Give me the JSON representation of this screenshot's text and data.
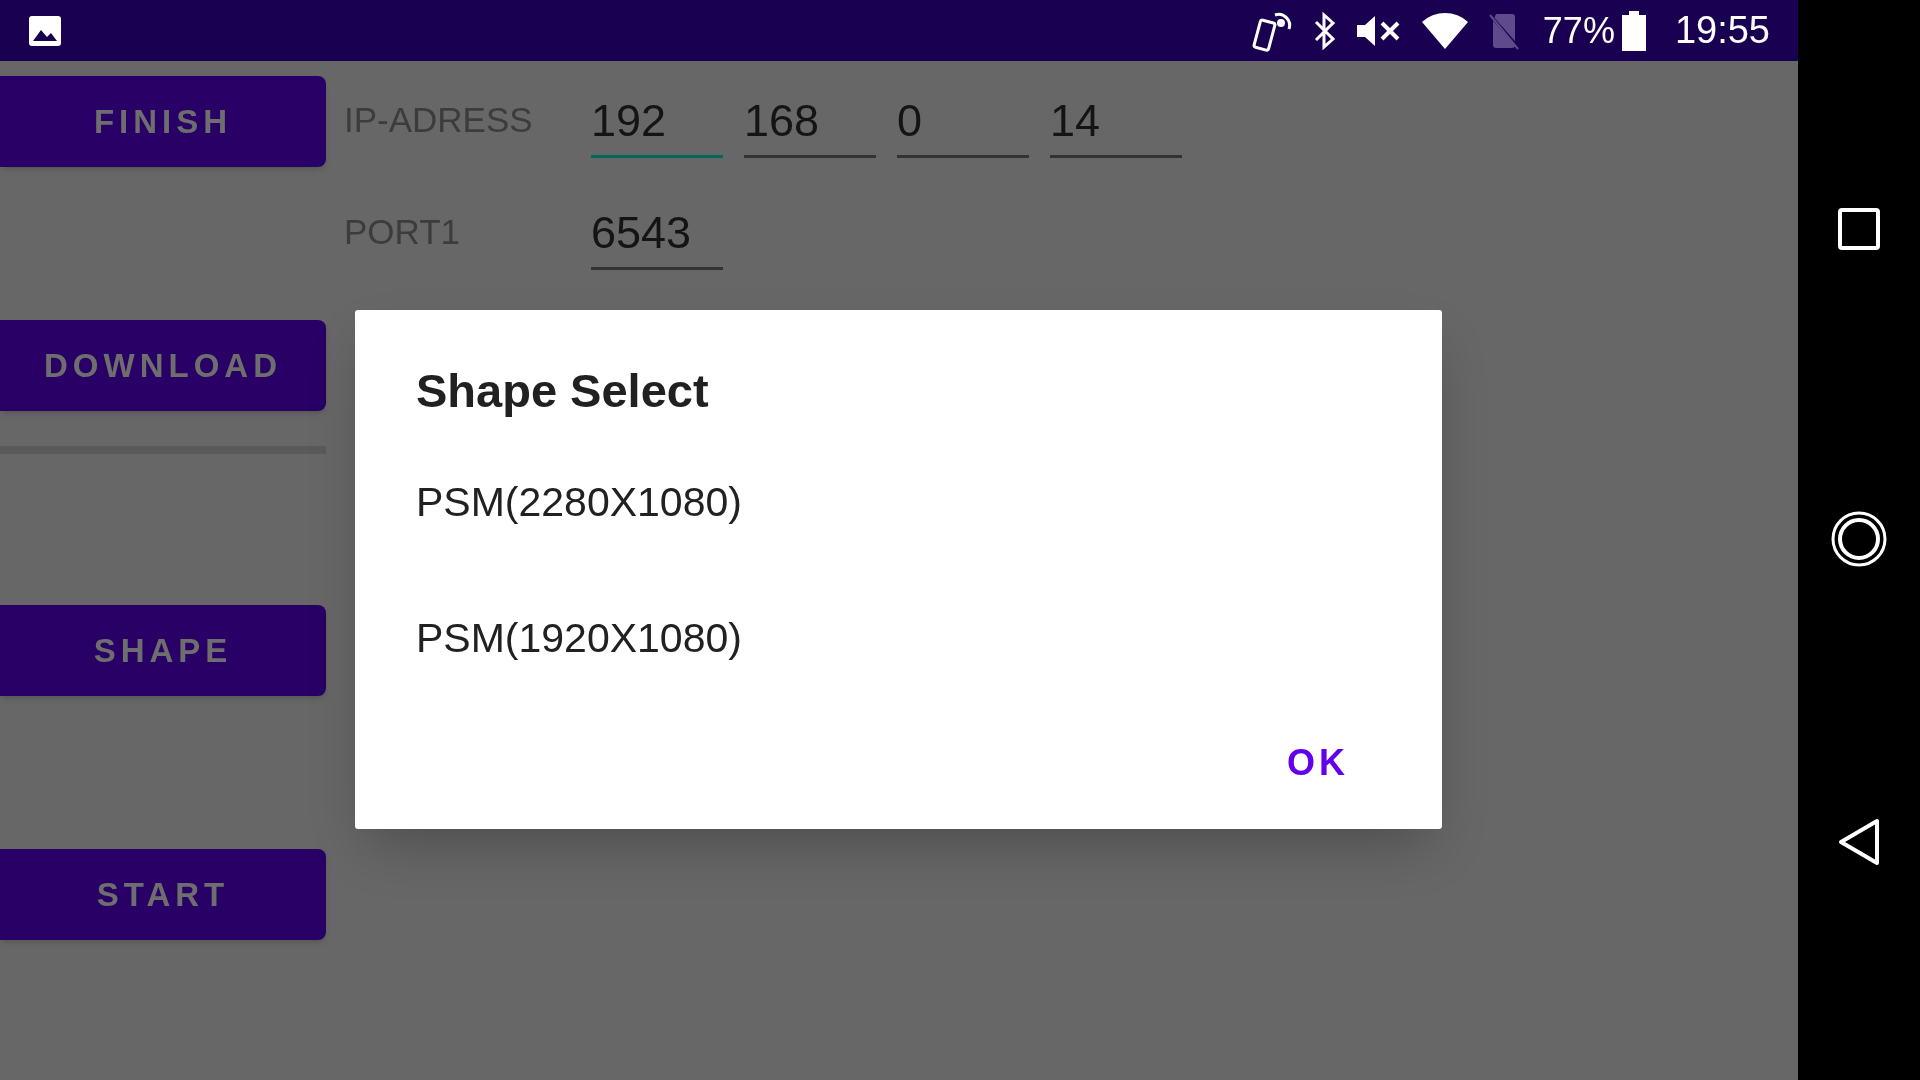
{
  "status_bar": {
    "battery": "77%",
    "time": "19:55"
  },
  "side_buttons": [
    {
      "label": "FINISH"
    },
    {
      "label": "DOWNLOAD"
    },
    {
      "label": "SHAPE"
    },
    {
      "label": "START"
    }
  ],
  "form": {
    "ip_label": "IP-ADRESS",
    "ip_fields": [
      {
        "value": "192",
        "focused": true
      },
      {
        "value": "168",
        "focused": false
      },
      {
        "value": "0",
        "focused": false
      },
      {
        "value": "14",
        "focused": false
      }
    ],
    "port_label": "PORT1",
    "port_value": "6543"
  },
  "dialog": {
    "title": "Shape Select",
    "options": [
      "PSM(2280X1080)",
      "PSM(1920X1080)"
    ],
    "button": "OK"
  }
}
